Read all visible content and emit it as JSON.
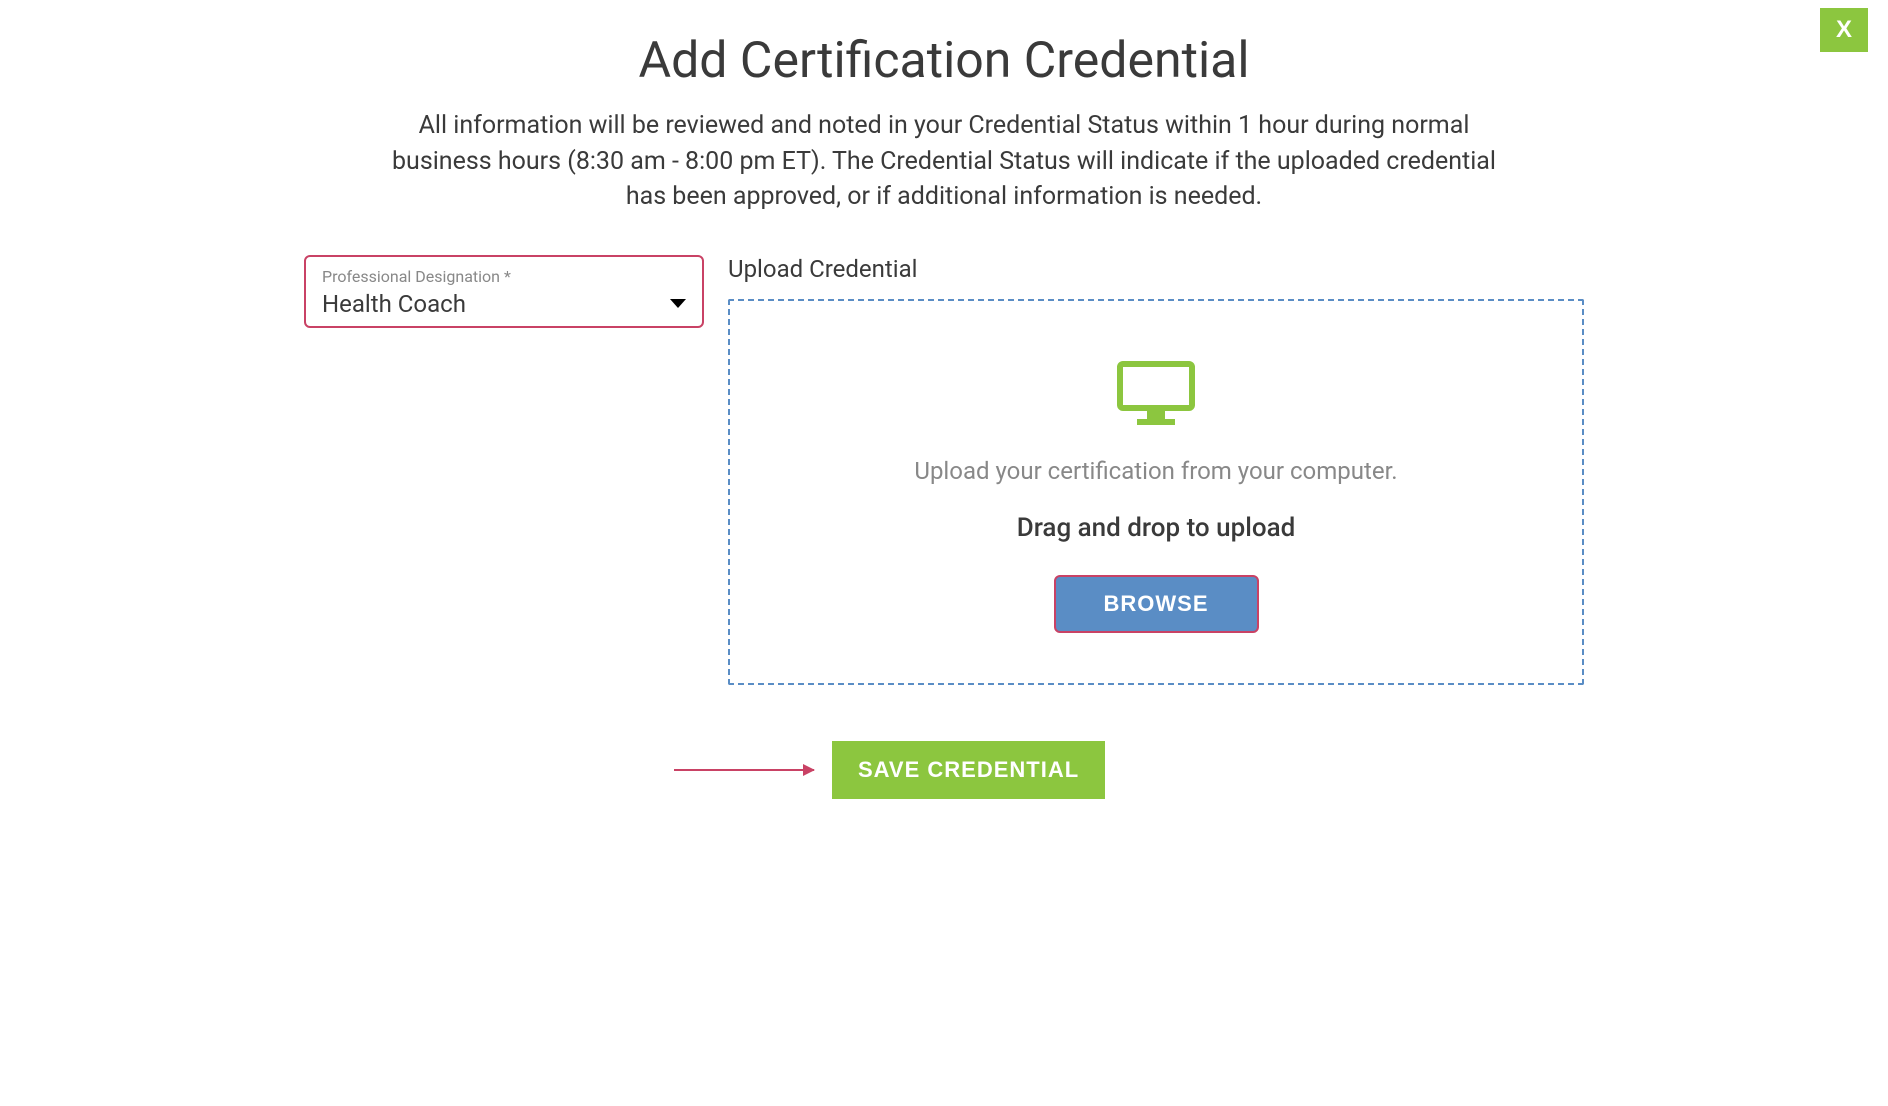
{
  "header": {
    "title": "Add Certification Credential",
    "description": "All information will be reviewed and noted in your Credential Status within 1 hour during normal business hours (8:30 am - 8:00 pm ET). The Credential Status will indicate if the uploaded credential has been approved, or if additional information is needed."
  },
  "close_label": "X",
  "designation": {
    "label": "Professional Designation *",
    "selected_value": "Health Coach"
  },
  "upload": {
    "section_label": "Upload Credential",
    "hint": "Upload your certification from your computer.",
    "drag_text": "Drag and drop to upload",
    "browse_label": "BROWSE"
  },
  "actions": {
    "save_label": "SAVE CREDENTIAL"
  },
  "colors": {
    "accent_green": "#8cc63f",
    "accent_blue": "#5a8dc5",
    "highlight_red": "#c94265"
  }
}
